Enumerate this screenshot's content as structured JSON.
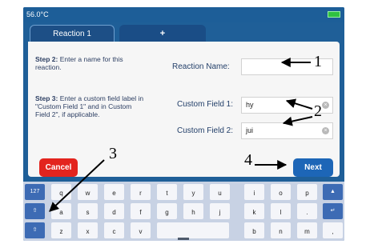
{
  "status": {
    "temperature": "56.0°C"
  },
  "tabs": [
    {
      "label": "Reaction 1"
    },
    {
      "label": "+"
    }
  ],
  "steps": {
    "step2": {
      "prefix": "Step 2:",
      "text": "Enter a name for this reaction."
    },
    "step3": {
      "prefix": "Step 3:",
      "text": "Enter a custom field label in \"Custom Field 1\" and in Custom Field 2\", if applicable."
    }
  },
  "fields": {
    "reaction_name": {
      "label": "Reaction Name:",
      "value": ""
    },
    "custom1": {
      "label": "Custom Field 1:",
      "value": "hy"
    },
    "custom2": {
      "label": "Custom Field 2:",
      "value": "jui"
    }
  },
  "buttons": {
    "cancel": "Cancel",
    "next": "Next"
  },
  "annotations": {
    "n1": "1",
    "n2": "2",
    "n3": "3",
    "n4": "4"
  },
  "keyboard": {
    "row1": {
      "left": "127",
      "keys": [
        "q",
        "w",
        "e",
        "r",
        "t",
        "y",
        "u",
        "i",
        "o",
        "p"
      ]
    },
    "row2": {
      "keys": [
        "a",
        "s",
        "d",
        "f",
        "g",
        "h",
        "j",
        "k",
        "l"
      ]
    },
    "row3": {
      "keys": [
        "z",
        "x",
        "c",
        "v",
        "",
        "",
        "b",
        "n",
        "m",
        ","
      ]
    },
    "row1_right_icon": "up-arrow-icon",
    "row2_right_icon": "enter-icon",
    "row3_left_icon": "shift-icon"
  },
  "colors": {
    "panel_blue": "#1f5f98",
    "cancel_red": "#e3241e",
    "next_blue": "#1d66b7",
    "battery_green": "#2fc141"
  }
}
